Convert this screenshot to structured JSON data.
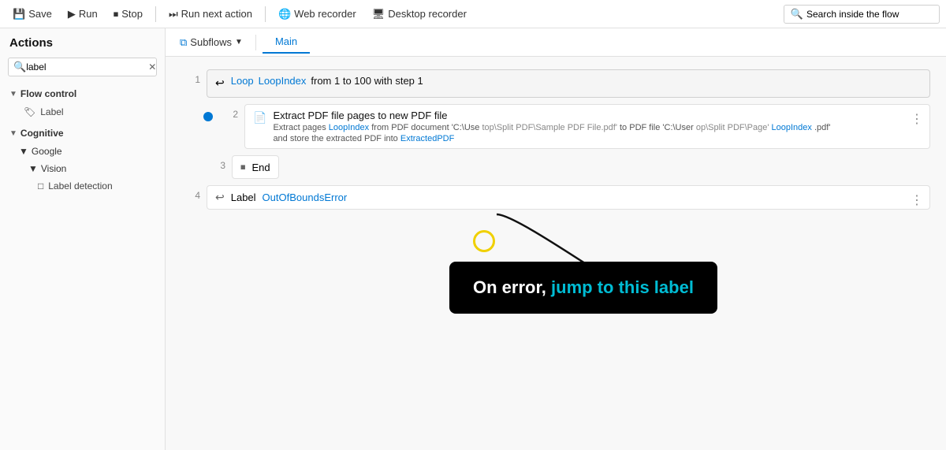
{
  "toolbar": {
    "save_label": "Save",
    "run_label": "Run",
    "stop_label": "Stop",
    "run_next_label": "Run next action",
    "web_recorder_label": "Web recorder",
    "desktop_recorder_label": "Desktop recorder",
    "search_placeholder": "Search inside the flow"
  },
  "sidebar": {
    "title": "Actions",
    "search_value": "label",
    "search_placeholder": "",
    "sections": [
      {
        "label": "Flow control",
        "items": [
          {
            "label": "Label"
          }
        ]
      },
      {
        "label": "Cognitive",
        "subsections": [
          {
            "label": "Google",
            "sub": [
              {
                "label": "Vision",
                "items": [
                  {
                    "label": "Label detection"
                  }
                ]
              }
            ]
          }
        ]
      }
    ]
  },
  "tabs": {
    "subflows_label": "Subflows",
    "main_label": "Main"
  },
  "flow": {
    "rows": [
      {
        "line": "1",
        "type": "loop",
        "keyword": "Loop",
        "var": "LoopIndex",
        "detail": "from 1 to 100 with step 1"
      },
      {
        "line": "2",
        "type": "extract",
        "title": "Extract PDF file pages to new PDF file",
        "detail1": "Extract pages",
        "detail1_var": "LoopIndex",
        "detail1_rest": "from PDF document 'C:\\Use",
        "detail1_path": "top\\Split PDF\\Sample PDF File.pdf'",
        "detail2_pre": "to PDF file 'C:\\User",
        "detail2_path": "op\\Split PDF\\Page'",
        "detail2_var": "LoopIndex",
        "detail2_ext": ".pdf'",
        "detail3": "and store the extracted PDF into",
        "detail3_var": "ExtractedPDF"
      },
      {
        "line": "3",
        "type": "end",
        "label": "End"
      },
      {
        "line": "4",
        "type": "label",
        "keyword": "Label",
        "var": "OutOfBoundsError"
      }
    ]
  },
  "callout": {
    "text_prefix": "On error, ",
    "text_highlight": "jump to this label",
    "text_suffix": ""
  },
  "icons": {
    "save": "💾",
    "run": "▶",
    "stop": "⏹",
    "run_next": "⏭",
    "web": "🌐",
    "desktop": "🖥",
    "search": "🔍",
    "label": "🏷",
    "loop": "↩",
    "pdf": "📄",
    "end": "⏹",
    "label_action": "↩"
  }
}
